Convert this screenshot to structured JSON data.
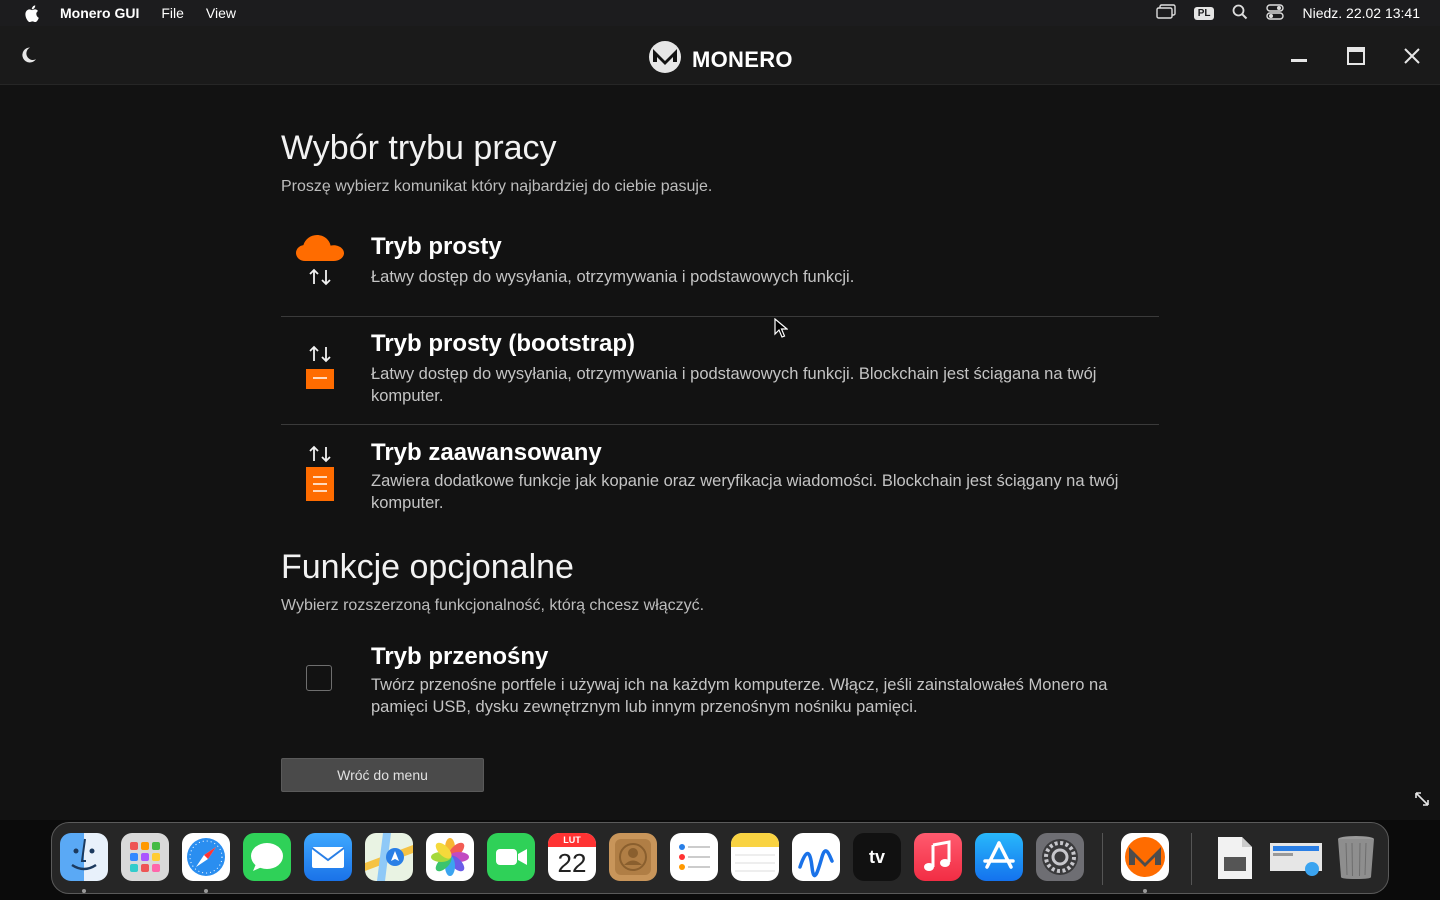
{
  "menubar": {
    "app_name": "Monero GUI",
    "menus": [
      "File",
      "View"
    ],
    "input_source": "PL",
    "datetime": "Niedz. 22.02  13:41"
  },
  "titlebar": {
    "brand": "MONERO"
  },
  "mode_section": {
    "title": "Wybór trybu pracy",
    "subtitle": "Proszę wybierz komunikat który najbardziej do ciebie pasuje."
  },
  "options": [
    {
      "title": "Tryb prosty",
      "description": "Łatwy dostęp do wysyłania, otrzymywania i podstawowych funkcji.",
      "icon": "cloud-sync-icon"
    },
    {
      "title": "Tryb prosty (bootstrap)",
      "description": "Łatwy dostęp do wysyłania, otrzymywania i podstawowych funkcji. Blockchain jest ściągana na twój komputer.",
      "icon": "bootstrap-server-icon"
    },
    {
      "title": "Tryb zaawansowany",
      "description": "Zawiera dodatkowe funkcje jak kopanie oraz weryfikacja wiadomości. Blockchain jest ściągany na twój komputer.",
      "icon": "full-node-server-icon"
    }
  ],
  "optional_section": {
    "title": "Funkcje opcjonalne",
    "subtitle": "Wybierz rozszerzoną funkcjonalność, którą chcesz włączyć."
  },
  "portable": {
    "title": "Tryb przenośny",
    "description": "Twórz przenośne portfele i używaj ich na każdym komputerze. Włącz, jeśli zainstalowałeś Monero na pamięci USB, dysku zewnętrznym lub innym przenośnym nośniku pamięci.",
    "checked": false
  },
  "back_button": "Wróć do menu",
  "dock": {
    "calendar_month": "LUT",
    "calendar_day": "22",
    "tv_label": "tv",
    "apps": [
      "Finder",
      "Launchpad",
      "Safari",
      "Messages",
      "Mail",
      "Maps",
      "Photos",
      "FaceTime",
      "Calendar",
      "Contacts",
      "Reminders",
      "Notes",
      "Freeform",
      "TV",
      "Music",
      "App Store",
      "System Settings",
      "Monero GUI",
      "Preview",
      "Screen Sharing",
      "Trash"
    ]
  },
  "colors": {
    "accent": "#ff6c00",
    "background": "#121212"
  }
}
